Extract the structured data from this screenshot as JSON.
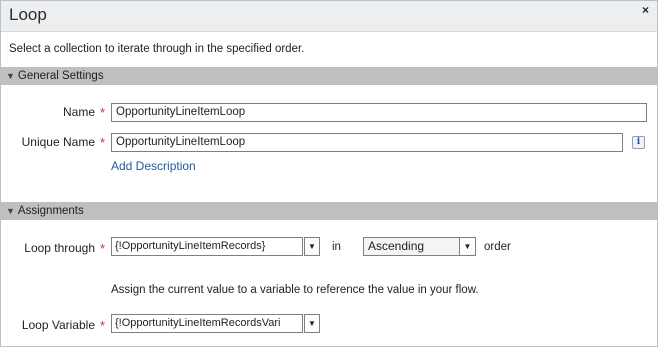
{
  "dialog": {
    "title": "Loop",
    "close_glyph": "×",
    "intro": "Select a collection to iterate through in the specified order."
  },
  "general": {
    "header": "General Settings",
    "name_label": "Name",
    "name_value": "OpportunityLineItemLoop",
    "unique_label": "Unique Name",
    "unique_value": "OpportunityLineItemLoop",
    "info_glyph": "i",
    "add_description": "Add Description"
  },
  "assignments": {
    "header": "Assignments",
    "loop_through_label": "Loop through",
    "loop_through_value": "{!OpportunityLineItemRecords}",
    "in_text": "in",
    "order_value": "Ascending",
    "order_text": "order",
    "hint": "Assign the current value to a variable to reference the value in your flow.",
    "loop_variable_label": "Loop Variable",
    "loop_variable_value": "{!OpportunityLineItemRecordsVari"
  },
  "required_marker": "*",
  "collapse_glyph": "▼",
  "dropdown_glyph": "▼",
  "icons": [
    "close-icon",
    "info-icon",
    "collapse-triangle-icon",
    "dropdown-arrow-icon"
  ],
  "colors": {
    "section_header_bg": "#bfbfbf",
    "titlebar_bg": "#eceef0",
    "required": "#c23934",
    "link": "#1f5a99"
  }
}
